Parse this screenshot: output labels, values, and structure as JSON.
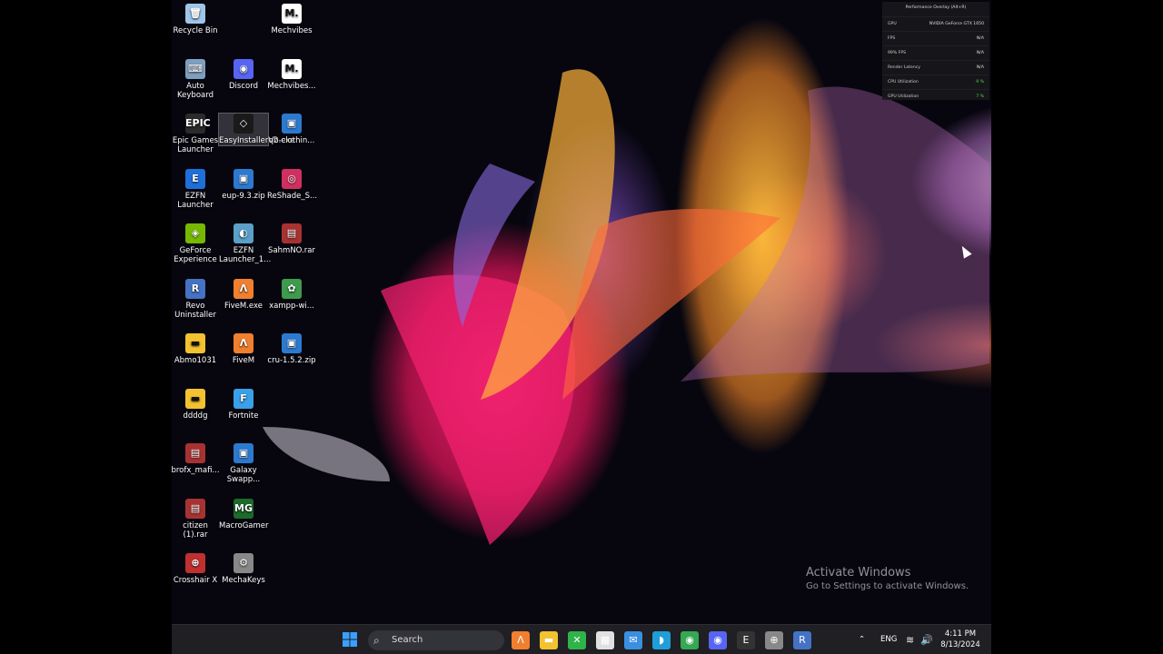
{
  "desktop_icons": [
    {
      "label": "Recycle Bin",
      "glyph": "🗑",
      "color": "#9fc5e8"
    },
    {
      "label": "Mechvibes",
      "glyph": "M.",
      "color": "#ffffff"
    },
    {
      "label": "Auto Keyboard",
      "glyph": "⌨",
      "color": "#7f9fbf"
    },
    {
      "label": "Discord",
      "glyph": "◉",
      "color": "#5865f2"
    },
    {
      "label": "Mechvibes...",
      "glyph": "M.",
      "color": "#ffffff"
    },
    {
      "label": "Epic Games Launcher",
      "glyph": "EPIC",
      "color": "#2b2b2b"
    },
    {
      "label": "EasyInstallerV2.exe",
      "glyph": "◇",
      "color": "#1a1a1a"
    },
    {
      "label": "qb-clothin...",
      "glyph": "▣",
      "color": "#2b7ad0"
    },
    {
      "label": "EZFN Launcher",
      "glyph": "E",
      "color": "#1e6fd9"
    },
    {
      "label": "eup-9.3.zip",
      "glyph": "▣",
      "color": "#2b7ad0"
    },
    {
      "label": "ReShade_S...",
      "glyph": "◎",
      "color": "#d03060"
    },
    {
      "label": "GeForce Experience",
      "glyph": "◈",
      "color": "#76b900"
    },
    {
      "label": "EZFN Launcher_1...",
      "glyph": "◐",
      "color": "#5aa0c8"
    },
    {
      "label": "SahmNO.rar",
      "glyph": "▤",
      "color": "#a83232"
    },
    {
      "label": "Revo Uninstaller",
      "glyph": "R",
      "color": "#4472c4"
    },
    {
      "label": "FiveM.exe",
      "glyph": "Λ",
      "color": "#f08030"
    },
    {
      "label": "xampp-wi...",
      "glyph": "✿",
      "color": "#3e9b4e"
    },
    {
      "label": "Abmo1031",
      "glyph": "▬",
      "color": "#f2c230"
    },
    {
      "label": "FiveM",
      "glyph": "Λ",
      "color": "#f08030"
    },
    {
      "label": "cru-1.5.2.zip",
      "glyph": "▣",
      "color": "#2b7ad0"
    },
    {
      "label": "ddddg",
      "glyph": "▬",
      "color": "#f2c230"
    },
    {
      "label": "Fortnite",
      "glyph": "F",
      "color": "#3aa0e8"
    },
    {
      "label": "brofx_mafi...",
      "glyph": "▤",
      "color": "#a83232"
    },
    {
      "label": "Galaxy Swapp...",
      "glyph": "▣",
      "color": "#2b7ad0"
    },
    {
      "label": "citizen (1).rar",
      "glyph": "▤",
      "color": "#a83232"
    },
    {
      "label": "MacroGamer",
      "glyph": "MG",
      "color": "#1d6b2a"
    },
    {
      "label": "Crosshair X",
      "glyph": "⊕",
      "color": "#c03030"
    },
    {
      "label": "MechaKeys",
      "glyph": "⚙",
      "color": "#888888"
    }
  ],
  "overlay": {
    "title": "Performance Overlay (Alt+R)",
    "rows": [
      {
        "label": "GPU",
        "value": "NVIDIA GeForce GTX 1650"
      },
      {
        "label": "FPS",
        "value": "N/A"
      },
      {
        "label": "99% FPS",
        "value": "N/A"
      },
      {
        "label": "Render Latency",
        "value": "N/A"
      },
      {
        "label": "CPU Utilization",
        "value": "9 %"
      },
      {
        "label": "GPU Utilization",
        "value": "7 %"
      }
    ]
  },
  "activation": {
    "title": "Activate Windows",
    "subtitle": "Go to Settings to activate Windows."
  },
  "taskbar": {
    "search_placeholder": "Search",
    "apps": [
      {
        "name": "fivem",
        "glyph": "Λ",
        "color": "#f08030"
      },
      {
        "name": "file-explorer",
        "glyph": "▬",
        "color": "#f2c230"
      },
      {
        "name": "xbox",
        "glyph": "✕",
        "color": "#2fb44a"
      },
      {
        "name": "store",
        "glyph": "▦",
        "color": "#e0e0e0"
      },
      {
        "name": "mail",
        "glyph": "✉",
        "color": "#3a8fe0"
      },
      {
        "name": "edge",
        "glyph": "◗",
        "color": "#1f9ed8"
      },
      {
        "name": "chrome",
        "glyph": "◉",
        "color": "#34a853"
      },
      {
        "name": "discord",
        "glyph": "◉",
        "color": "#5865f2"
      },
      {
        "name": "epic-games",
        "glyph": "E",
        "color": "#333333"
      },
      {
        "name": "crosshair",
        "glyph": "⊕",
        "color": "#888888"
      },
      {
        "name": "revo",
        "glyph": "R",
        "color": "#4472c4"
      }
    ],
    "lang": "ENG",
    "time": "4:11 PM",
    "date": "8/13/2024"
  }
}
